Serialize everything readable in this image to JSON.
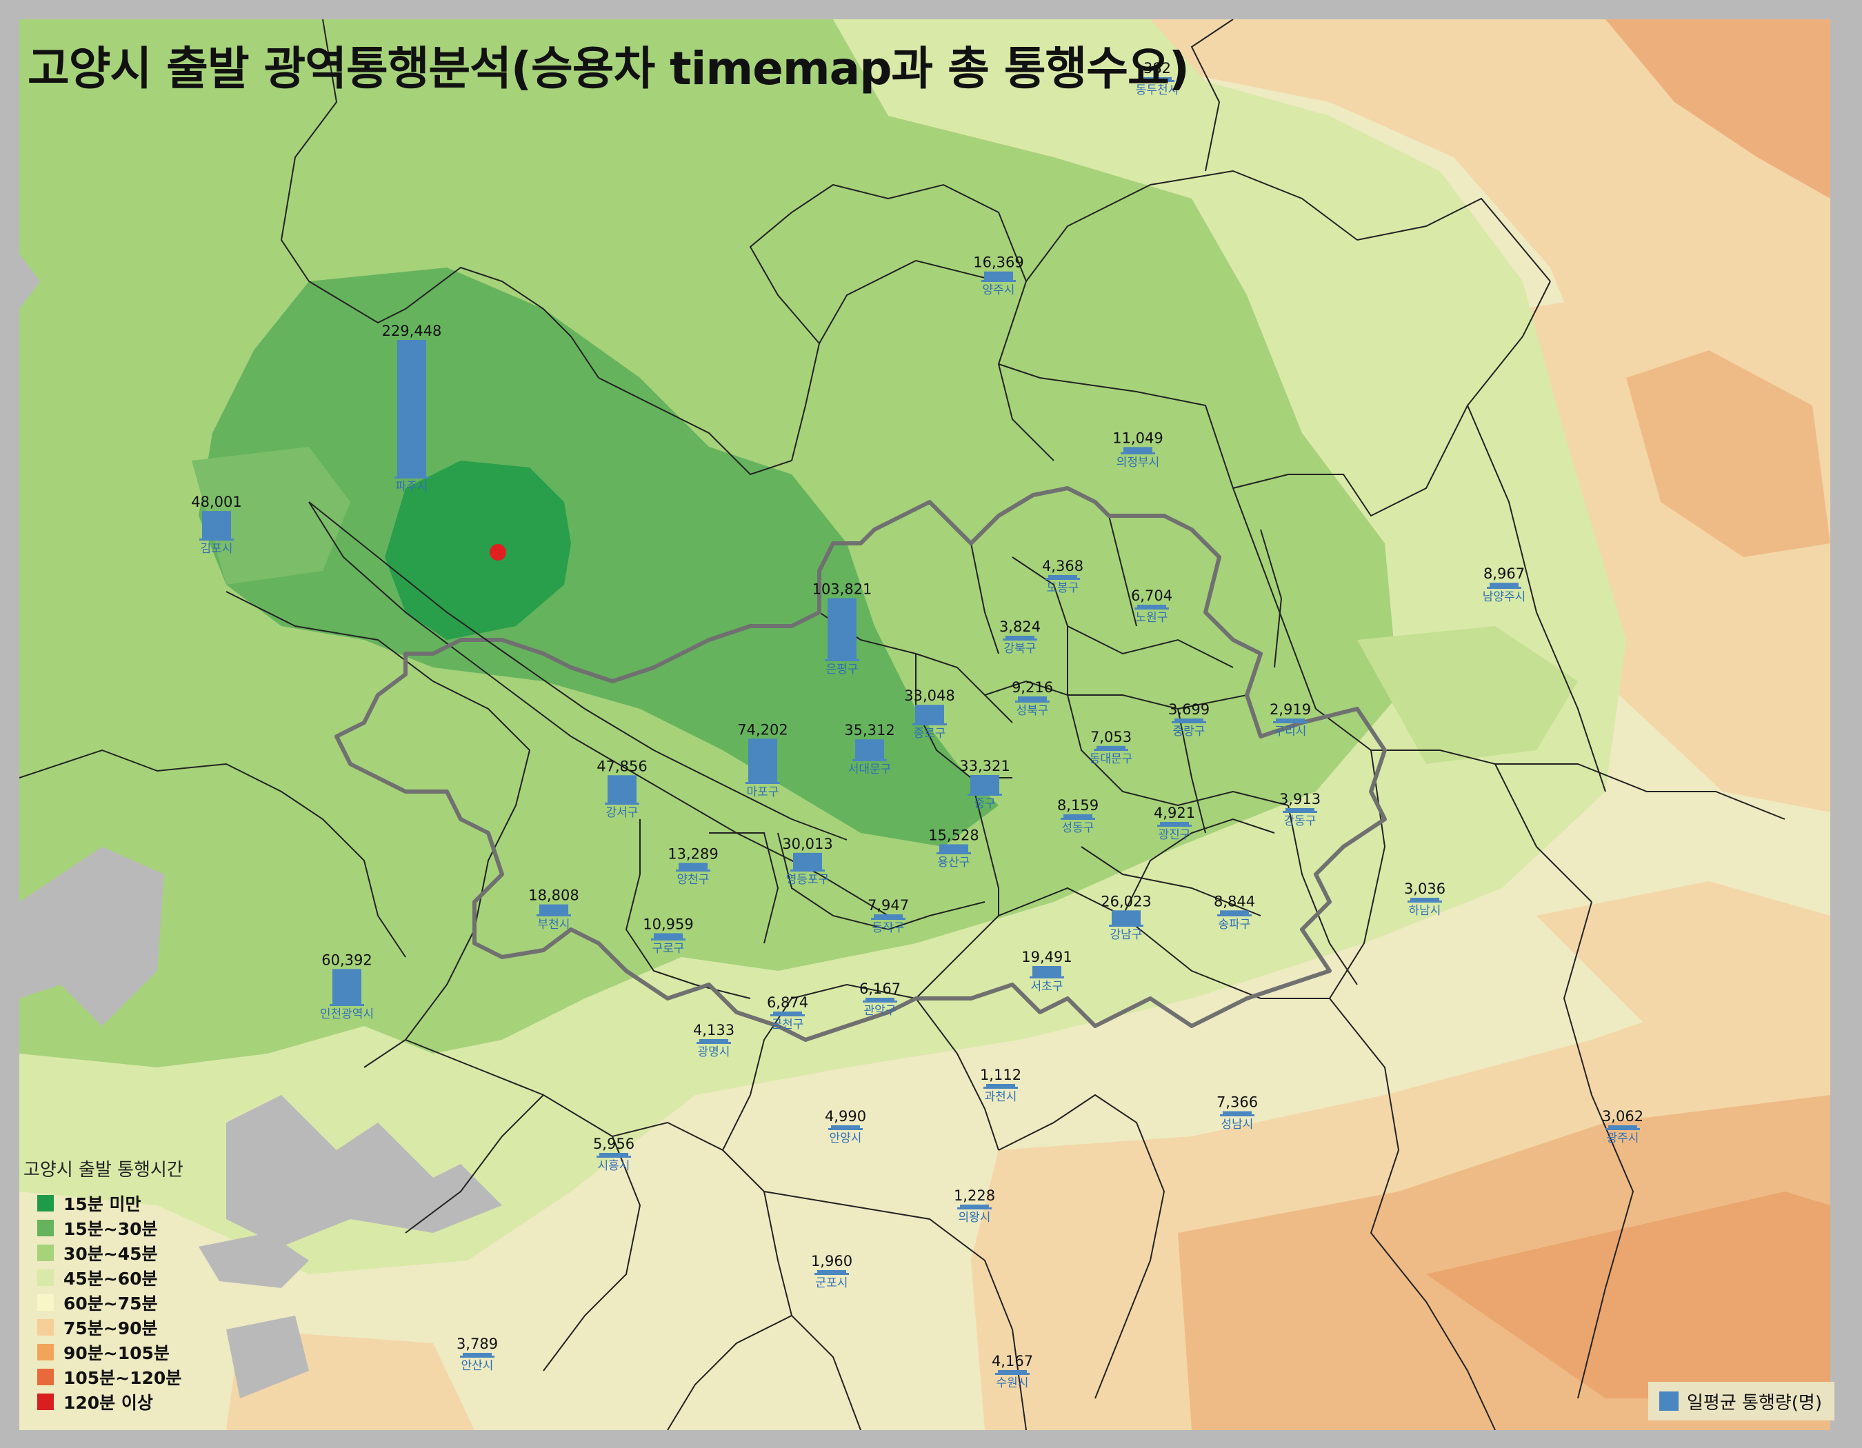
{
  "title": "고양시 출발 광역통행분석(승용차 timemap과 총 통행수요)",
  "colors": {
    "bar": "#4a86c0",
    "name": "#2f6fb5",
    "origin": "#e02020",
    "boundary": "#222222",
    "seoul_boundary": "#707070"
  },
  "legend": {
    "title": "고양시 출발 통행시간",
    "items": [
      {
        "label": "15분 미만",
        "color": "#1f9a48"
      },
      {
        "label": "15분~30분",
        "color": "#66b35e"
      },
      {
        "label": "30분~45분",
        "color": "#a6d27a"
      },
      {
        "label": "45분~60분",
        "color": "#d9e9a8"
      },
      {
        "label": "60분~75분",
        "color": "#f8f5c8"
      },
      {
        "label": "75분~90분",
        "color": "#f6cf98"
      },
      {
        "label": "90분~105분",
        "color": "#f2a35c"
      },
      {
        "label": "105분~120분",
        "color": "#e86a3a"
      },
      {
        "label": "120분 이상",
        "color": "#d81e1e"
      }
    ]
  },
  "volume_legend": {
    "label": "일평균 통행량(명)"
  },
  "regions": [
    {
      "name": "파주시",
      "value": 229448
    },
    {
      "name": "김포시",
      "value": 48001
    },
    {
      "name": "양주시",
      "value": 16369
    },
    {
      "name": "동두천시",
      "value": 382
    },
    {
      "name": "의정부시",
      "value": 11049
    },
    {
      "name": "도봉구",
      "value": 4368
    },
    {
      "name": "노원구",
      "value": 6704
    },
    {
      "name": "강북구",
      "value": 3824
    },
    {
      "name": "남양주시",
      "value": 8967
    },
    {
      "name": "은평구",
      "value": 103821
    },
    {
      "name": "종로구",
      "value": 33048
    },
    {
      "name": "성북구",
      "value": 9216
    },
    {
      "name": "중랑구",
      "value": 3699
    },
    {
      "name": "구리시",
      "value": 2919
    },
    {
      "name": "서대문구",
      "value": 35312
    },
    {
      "name": "마포구",
      "value": 74202
    },
    {
      "name": "동대문구",
      "value": 7053
    },
    {
      "name": "중구",
      "value": 33321
    },
    {
      "name": "강서구",
      "value": 47856
    },
    {
      "name": "성동구",
      "value": 8159
    },
    {
      "name": "광진구",
      "value": 4921
    },
    {
      "name": "강동구",
      "value": 3913
    },
    {
      "name": "양천구",
      "value": 13289
    },
    {
      "name": "영등포구",
      "value": 30013
    },
    {
      "name": "용산구",
      "value": 15528
    },
    {
      "name": "부천시",
      "value": 18808
    },
    {
      "name": "동작구",
      "value": 7947
    },
    {
      "name": "강남구",
      "value": 26023
    },
    {
      "name": "송파구",
      "value": 8844
    },
    {
      "name": "하남시",
      "value": 3036
    },
    {
      "name": "구로구",
      "value": 10959
    },
    {
      "name": "인천광역시",
      "value": 60392
    },
    {
      "name": "서초구",
      "value": 19491
    },
    {
      "name": "금천구",
      "value": 6874
    },
    {
      "name": "관악구",
      "value": 6167
    },
    {
      "name": "광명시",
      "value": 4133
    },
    {
      "name": "과천시",
      "value": 1112
    },
    {
      "name": "성남시",
      "value": 7366
    },
    {
      "name": "광주시",
      "value": 3062
    },
    {
      "name": "안양시",
      "value": 4990
    },
    {
      "name": "시흥시",
      "value": 5956
    },
    {
      "name": "의왕시",
      "value": 1228
    },
    {
      "name": "군포시",
      "value": 1960
    },
    {
      "name": "안산시",
      "value": 3789
    },
    {
      "name": "수원시",
      "value": 4167
    }
  ]
}
